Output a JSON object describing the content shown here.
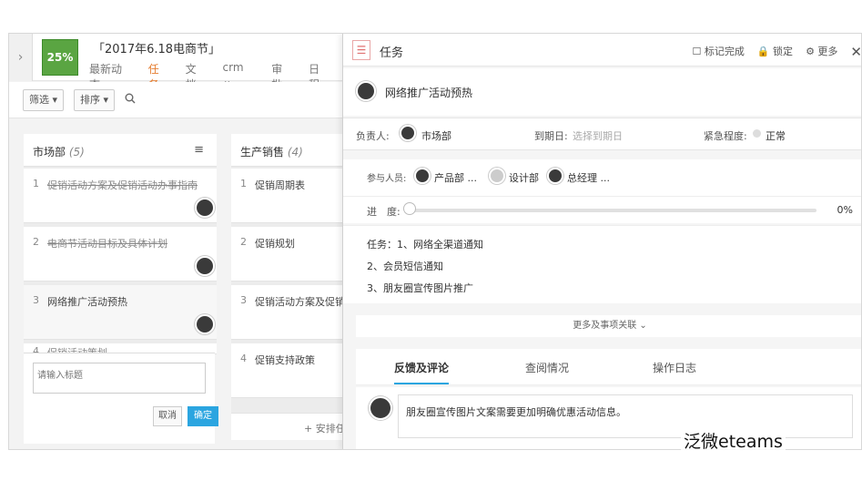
{
  "header": {
    "badge": "25%",
    "project_title": "「2017年6.18电商节」",
    "tabs": [
      "最新动态",
      "任务",
      "文档",
      "crm ⌄",
      "审批",
      "日程"
    ]
  },
  "toolbar": {
    "filter": "筛选 ▾",
    "sort": "排序 ▾"
  },
  "columns": [
    {
      "title": "市场部",
      "count": "(5)",
      "cards": [
        {
          "num": "1",
          "text": "促销活动方案及促销活动办事指南",
          "done": true
        },
        {
          "num": "2",
          "text": "电商节活动目标及具体计划",
          "done": true
        },
        {
          "num": "3",
          "text": "网络推广活动预热",
          "done": false
        },
        {
          "num": "4",
          "text": "促销活动策划",
          "done": true
        }
      ]
    },
    {
      "title": "生产销售",
      "count": "(4)",
      "cards": [
        {
          "num": "1",
          "text": "促销周期表"
        },
        {
          "num": "2",
          "text": "促销规划"
        },
        {
          "num": "3",
          "text": "促销活动方案及促销"
        },
        {
          "num": "4",
          "text": "促销支持政策"
        }
      ]
    }
  ],
  "quick_add": {
    "placeholder": "请输入标题",
    "cancel": "取消",
    "ok": "确定"
  },
  "schedule": "+ 安排任",
  "panel": {
    "header_title": "任务",
    "actions": [
      "☐ 标记完成",
      "🔒 锁定",
      "⚙ 更多"
    ],
    "task_name": "网络推广活动预热",
    "owner_label": "负责人:",
    "owner": "市场部",
    "due_label": "到期日:",
    "due_placeholder": "选择到期日",
    "urgency_label": "紧急程度:",
    "urgency": "正常",
    "participants_label": "参与人员:",
    "participants": [
      "产品部 ...",
      "设计部",
      "总经理 ..."
    ],
    "progress_label": "进　度:",
    "progress_value": "0%",
    "progress": 0,
    "description": [
      "任务：1、网络全渠道通知",
      "2、会员短信通知",
      "3、朋友圈宣传图片推广"
    ],
    "more": "更多及事项关联 ⌄",
    "tabs": [
      "反馈及评论",
      "查阅情况",
      "操作日志"
    ],
    "comment": "朋友圈宣传图片文案需要更加明确优惠活动信息。"
  },
  "watermark": "泛微eteams"
}
